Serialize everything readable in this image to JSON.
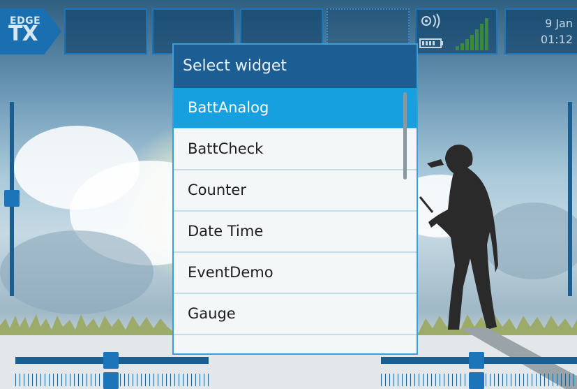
{
  "topbar": {
    "logo_edge": "EDGE",
    "logo_tx": "TX",
    "date": "9 Jan",
    "time": "01:12"
  },
  "dialog": {
    "title": "Select widget",
    "items": [
      {
        "label": "BattAnalog",
        "selected": true
      },
      {
        "label": "BattCheck",
        "selected": false
      },
      {
        "label": "Counter",
        "selected": false
      },
      {
        "label": "Date Time",
        "selected": false
      },
      {
        "label": "EventDemo",
        "selected": false
      },
      {
        "label": "Gauge",
        "selected": false
      },
      {
        "label": "",
        "selected": false
      }
    ]
  },
  "colors": {
    "accent": "#17a0e0",
    "title_bar": "#1c5e94",
    "trim": "#1a5f92"
  },
  "icons": [
    "antenna-signal-icon",
    "battery-icon",
    "signal-bars-icon"
  ]
}
